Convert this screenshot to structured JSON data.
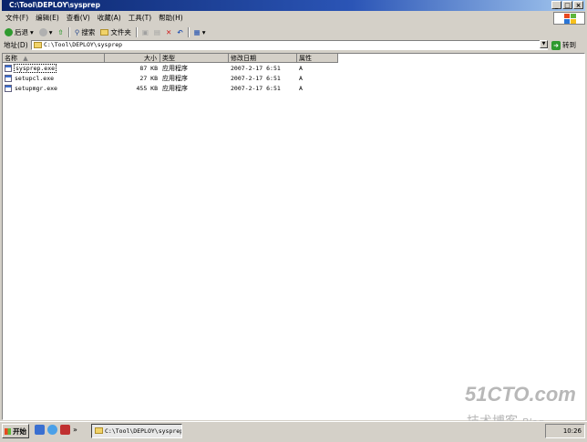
{
  "window": {
    "title": "C:\\Tool\\DEPLOY\\sysprep",
    "controls": [
      "_",
      "□",
      "×"
    ]
  },
  "menu": [
    "文件(F)",
    "编辑(E)",
    "查看(V)",
    "收藏(A)",
    "工具(T)",
    "帮助(H)"
  ],
  "toolbar": {
    "back": "后退",
    "search": "搜索",
    "folders": "文件夹"
  },
  "address": {
    "label": "地址(D)",
    "value": "C:\\Tool\\DEPLOY\\sysprep",
    "go": "转到"
  },
  "columns": [
    "名称",
    "大小",
    "类型",
    "修改日期",
    "属性"
  ],
  "files": [
    {
      "name": "sysprep.exe",
      "size": "87 KB",
      "type": "应用程序",
      "modified": "2007-2-17 6:51",
      "attr": "A"
    },
    {
      "name": "setupcl.exe",
      "size": "27 KB",
      "type": "应用程序",
      "modified": "2007-2-17 6:51",
      "attr": "A"
    },
    {
      "name": "setupmgr.exe",
      "size": "455 KB",
      "type": "应用程序",
      "modified": "2007-2-17 6:51",
      "attr": "A"
    }
  ],
  "watermark": {
    "site": "51CTO.com",
    "tagline": "技术博客",
    "suffix": "Blog"
  },
  "taskbar": {
    "start": "开始",
    "more": "»",
    "task": "C:\\Tool\\DEPLOY\\sysprep",
    "clock": "10:26"
  },
  "colors": {
    "titlebar": "#0a246a",
    "chrome": "#d4d0c8",
    "accent": "#2f9a2f"
  }
}
